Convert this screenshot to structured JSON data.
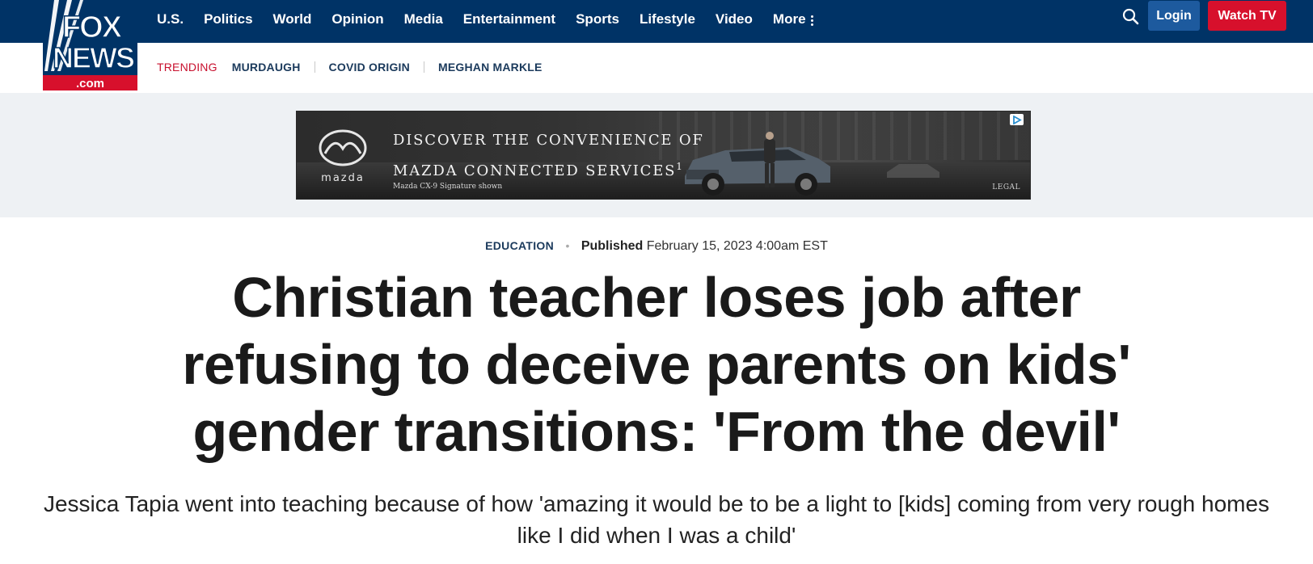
{
  "logo": {
    "line1": "FOX",
    "line2": "NEWS",
    "domain": ".com"
  },
  "nav": {
    "items": [
      "U.S.",
      "Politics",
      "World",
      "Opinion",
      "Media",
      "Entertainment",
      "Sports",
      "Lifestyle",
      "Video"
    ],
    "more_label": "More",
    "search_icon": "search-icon",
    "login_label": "Login",
    "watch_label": "Watch TV"
  },
  "trending": {
    "label": "TRENDING",
    "items": [
      "MURDAUGH",
      "COVID ORIGIN",
      "MEGHAN MARKLE"
    ]
  },
  "ad": {
    "brand": "mazda",
    "headline_line1": "DISCOVER THE CONVENIENCE OF",
    "headline_line2": "MAZDA CONNECTED SERVICES",
    "headline_sup": "1",
    "fine_print": "Mazda CX-9 Signature shown",
    "legal": "LEGAL"
  },
  "article": {
    "category": "EDUCATION",
    "published_label": "Published",
    "date": "February 15, 2023 4:00am EST",
    "headline": "Christian teacher loses job after refusing to deceive parents on kids' gender transitions: 'From the devil'",
    "dek": "Jessica Tapia went into teaching because of how 'amazing it would be to be a light to [kids] coming from very rough homes like I did when I was a child'"
  },
  "colors": {
    "navy": "#003366",
    "red": "#d7102c",
    "login_blue": "#1d5a9e",
    "trending_red": "#c8102e"
  }
}
